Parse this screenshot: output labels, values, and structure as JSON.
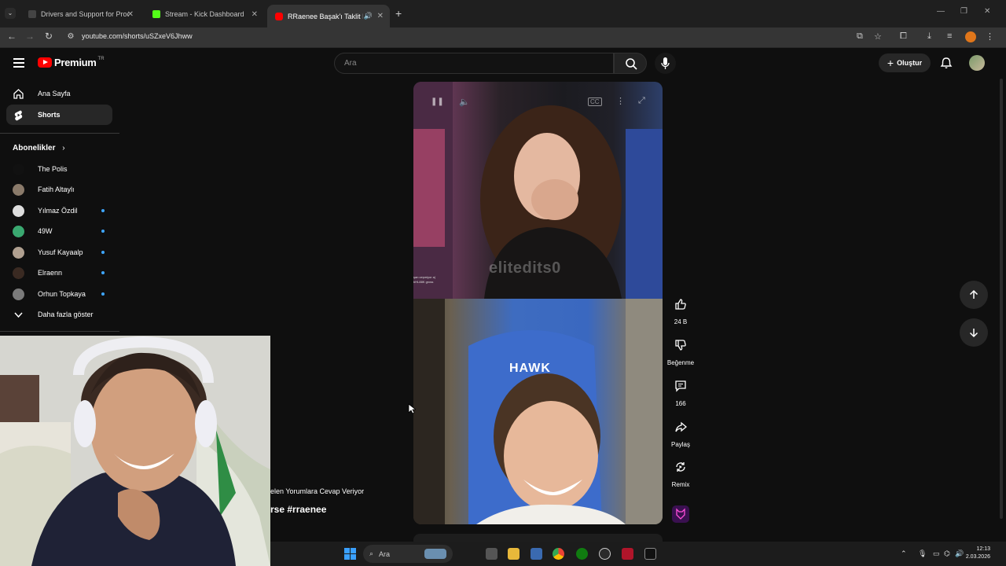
{
  "browser": {
    "tabs": [
      {
        "title": "Drivers and Support for Proce...",
        "color": "#444444"
      },
      {
        "title": "Stream - Kick Dashboard",
        "color": "#53fc18"
      },
      {
        "title": "RRaenee Başak'ı Taklit Eden...",
        "color": "#ff0000",
        "audio": "speaker-icon"
      }
    ],
    "new_tab": "+",
    "url": "youtube.com/shorts/uSZxeV6Jhww"
  },
  "header": {
    "logo_text": "Premium",
    "logo_region": "TR",
    "search_placeholder": "Ara",
    "create_label": "Oluştur"
  },
  "sidebar": {
    "main_items": [
      {
        "label": "Ana Sayfa",
        "icon": "home-icon"
      },
      {
        "label": "Shorts",
        "icon": "shorts-icon"
      }
    ],
    "subscriptions_title": "Abonelikler",
    "channels": [
      {
        "label": "The Polis",
        "new": false,
        "color": "#111111"
      },
      {
        "label": "Fatih Altaylı",
        "new": false,
        "color": "#8a7a6a"
      },
      {
        "label": "Yılmaz Özdil",
        "new": true,
        "color": "#dddddd"
      },
      {
        "label": "49W",
        "new": true,
        "color": "#3aa870"
      },
      {
        "label": "Yusuf Kayaalp",
        "new": true,
        "color": "#b0a090"
      },
      {
        "label": "Elraenn",
        "new": true,
        "color": "#3a2a22"
      },
      {
        "label": "Orhun Topkaya",
        "new": true,
        "color": "#7a7a7a"
      }
    ],
    "show_more": "Daha fazla göster"
  },
  "video": {
    "watermark": "elitedits0",
    "overlay_small_text": "şan ceşmiyor a| bHL88K gross",
    "chair_brand": "HAWK",
    "caption_line1": "elen Yorumlara Cevap Veriyor",
    "caption_line2": "rse #rraenee"
  },
  "actions": {
    "like_count": "24 B",
    "dislike_label": "Beğenme",
    "comments_count": "166",
    "share_label": "Paylaş",
    "remix_label": "Remix"
  },
  "taskbar": {
    "search_label": "Ara",
    "time": "12:13",
    "date": "2.03.2026"
  },
  "colors": {
    "accent_red": "#ff0000",
    "new_dot": "#3ea6ff",
    "bg": "#0f0f0f"
  }
}
